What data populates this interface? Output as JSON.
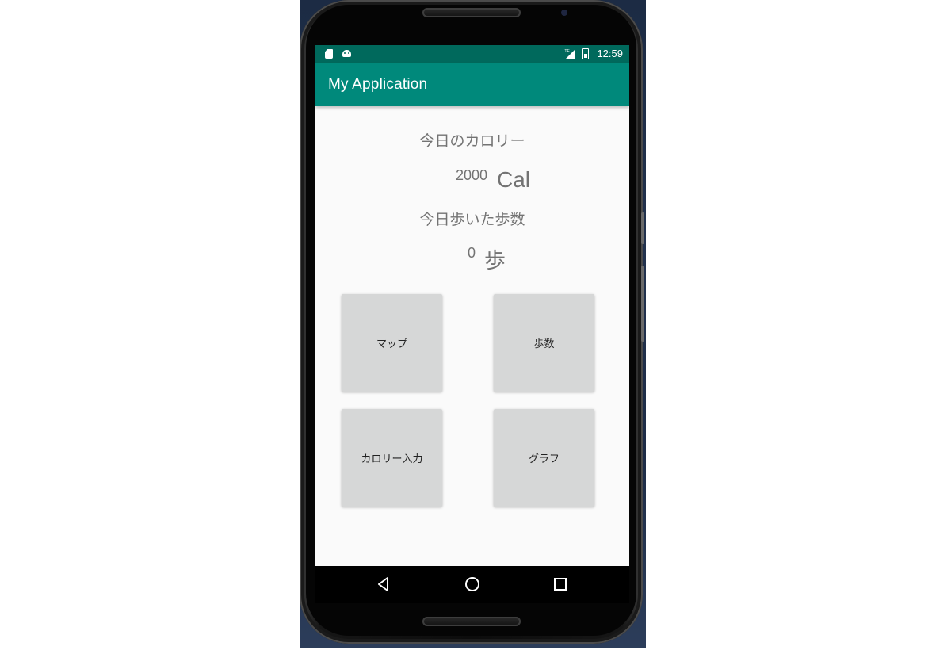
{
  "status_bar": {
    "time": "12:59",
    "icons": [
      "sd-card-icon",
      "android-debug-icon",
      "lte-signal-icon",
      "battery-charging-icon"
    ],
    "background_color": "#00695c"
  },
  "app_bar": {
    "title": "My Application",
    "background_color": "#00897b"
  },
  "calories": {
    "label": "今日のカロリー",
    "value": "2000",
    "unit": "Cal"
  },
  "steps": {
    "label": "今日歩いた歩数",
    "value": "0",
    "unit": "歩"
  },
  "buttons": {
    "map": "マップ",
    "steps": "歩数",
    "calorie_input": "カロリー入力",
    "graph": "グラフ"
  },
  "nav_bar": {
    "icons": [
      "back-icon",
      "home-icon",
      "recents-icon"
    ]
  }
}
